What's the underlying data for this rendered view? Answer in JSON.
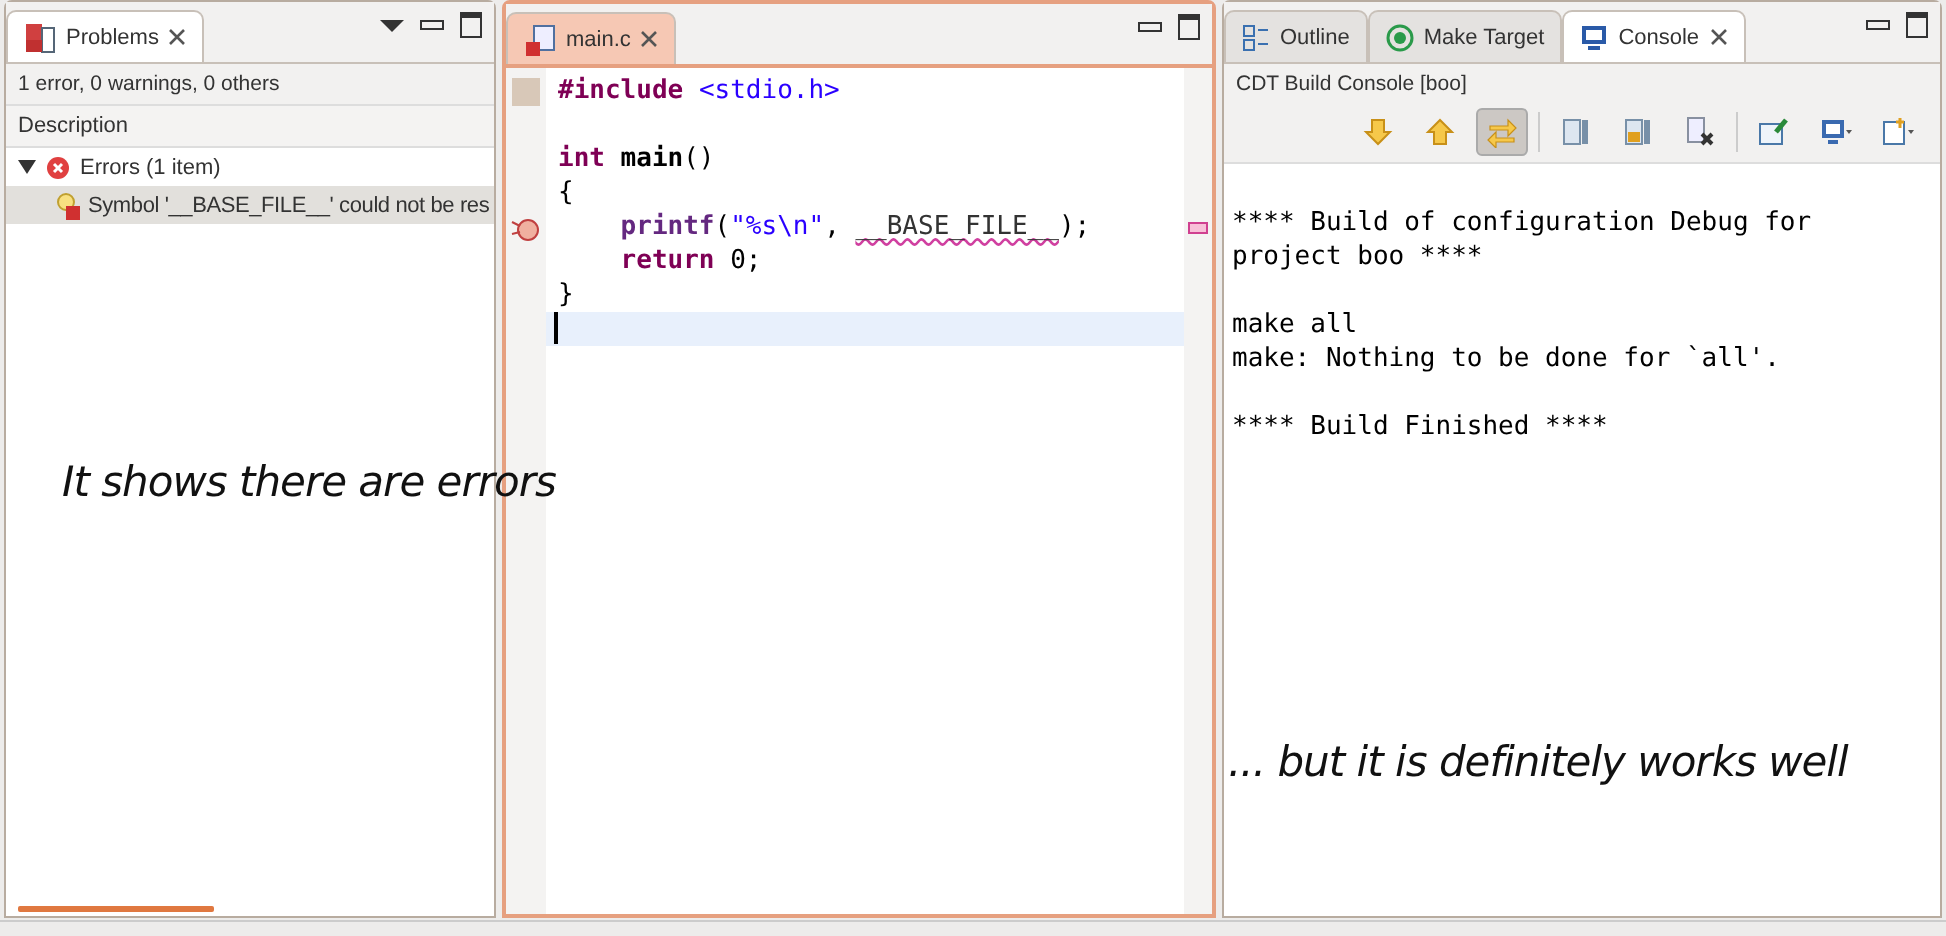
{
  "problems": {
    "tab": {
      "title": "Problems"
    },
    "summary": "1 error, 0 warnings, 0 others",
    "column": "Description",
    "groups": [
      {
        "label": "Errors (1 item)",
        "expanded": true,
        "children": [
          {
            "label": "Symbol '__BASE_FILE__' could not be res",
            "selected": true
          }
        ]
      }
    ],
    "annotation": "It shows there are errors"
  },
  "editor": {
    "tab": {
      "title": "main.c"
    },
    "lines": [
      {
        "kind": "code",
        "current": false,
        "error": false,
        "indented": false,
        "tokens": [
          {
            "kind": "keyword",
            "text": "#include"
          },
          {
            "kind": "header",
            "text": "<stdio.h>",
            "spaced": true
          }
        ]
      },
      {
        "kind": "blank",
        "current": false,
        "error": false
      },
      {
        "kind": "code",
        "current": false,
        "error": false,
        "indented": false,
        "tokens": [
          {
            "kind": "keyword",
            "text": "int"
          },
          {
            "kind": "bold",
            "text": "main",
            "spaced": true
          },
          {
            "kind": "plain",
            "text": "()"
          }
        ]
      },
      {
        "kind": "code",
        "current": false,
        "error": false,
        "indented": false,
        "tokens": [
          {
            "kind": "plain",
            "text": "{"
          }
        ]
      },
      {
        "kind": "code",
        "current": false,
        "error": true,
        "indented": true,
        "tokens": [
          {
            "kind": "function",
            "text": "printf"
          },
          {
            "kind": "plain",
            "text": "("
          },
          {
            "kind": "string",
            "text": "\"%s\\n\""
          },
          {
            "kind": "plain",
            "text": ","
          },
          {
            "kind": "squiggle",
            "text": "__BASE_FILE__",
            "spaced": true
          },
          {
            "kind": "plain",
            "text": ");"
          }
        ]
      },
      {
        "kind": "code",
        "current": false,
        "error": false,
        "indented": true,
        "tokens": [
          {
            "kind": "keyword",
            "text": "return"
          },
          {
            "kind": "plain",
            "text": "0;",
            "spaced": true
          }
        ]
      },
      {
        "kind": "code",
        "current": false,
        "error": false,
        "indented": false,
        "tokens": [
          {
            "kind": "plain",
            "text": "}"
          }
        ]
      },
      {
        "kind": "blank",
        "current": true,
        "error": false
      }
    ]
  },
  "console": {
    "tabs": [
      {
        "title": "Outline",
        "selected": false
      },
      {
        "title": "Make Target",
        "selected": false
      },
      {
        "title": "Console",
        "selected": true
      }
    ],
    "subtitle": "CDT Build Console [boo]",
    "toolbar": [
      {
        "kind": "down",
        "pressed": false
      },
      {
        "kind": "up",
        "pressed": false
      },
      {
        "kind": "swap",
        "pressed": true
      },
      {
        "kind": "sep"
      },
      {
        "kind": "save",
        "pressed": false
      },
      {
        "kind": "lock",
        "pressed": false
      },
      {
        "kind": "clear",
        "pressed": false
      },
      {
        "kind": "sep"
      },
      {
        "kind": "pin",
        "pressed": false
      },
      {
        "kind": "display",
        "pressed": false
      },
      {
        "kind": "new",
        "pressed": false
      }
    ],
    "output": [
      [
        "**** Build of configuration Debug for",
        "project boo ****"
      ],
      [
        "make all",
        "make: Nothing to be done for `all'."
      ],
      [
        "**** Build Finished ****"
      ]
    ],
    "annotation": "... but it is definitely works well"
  }
}
